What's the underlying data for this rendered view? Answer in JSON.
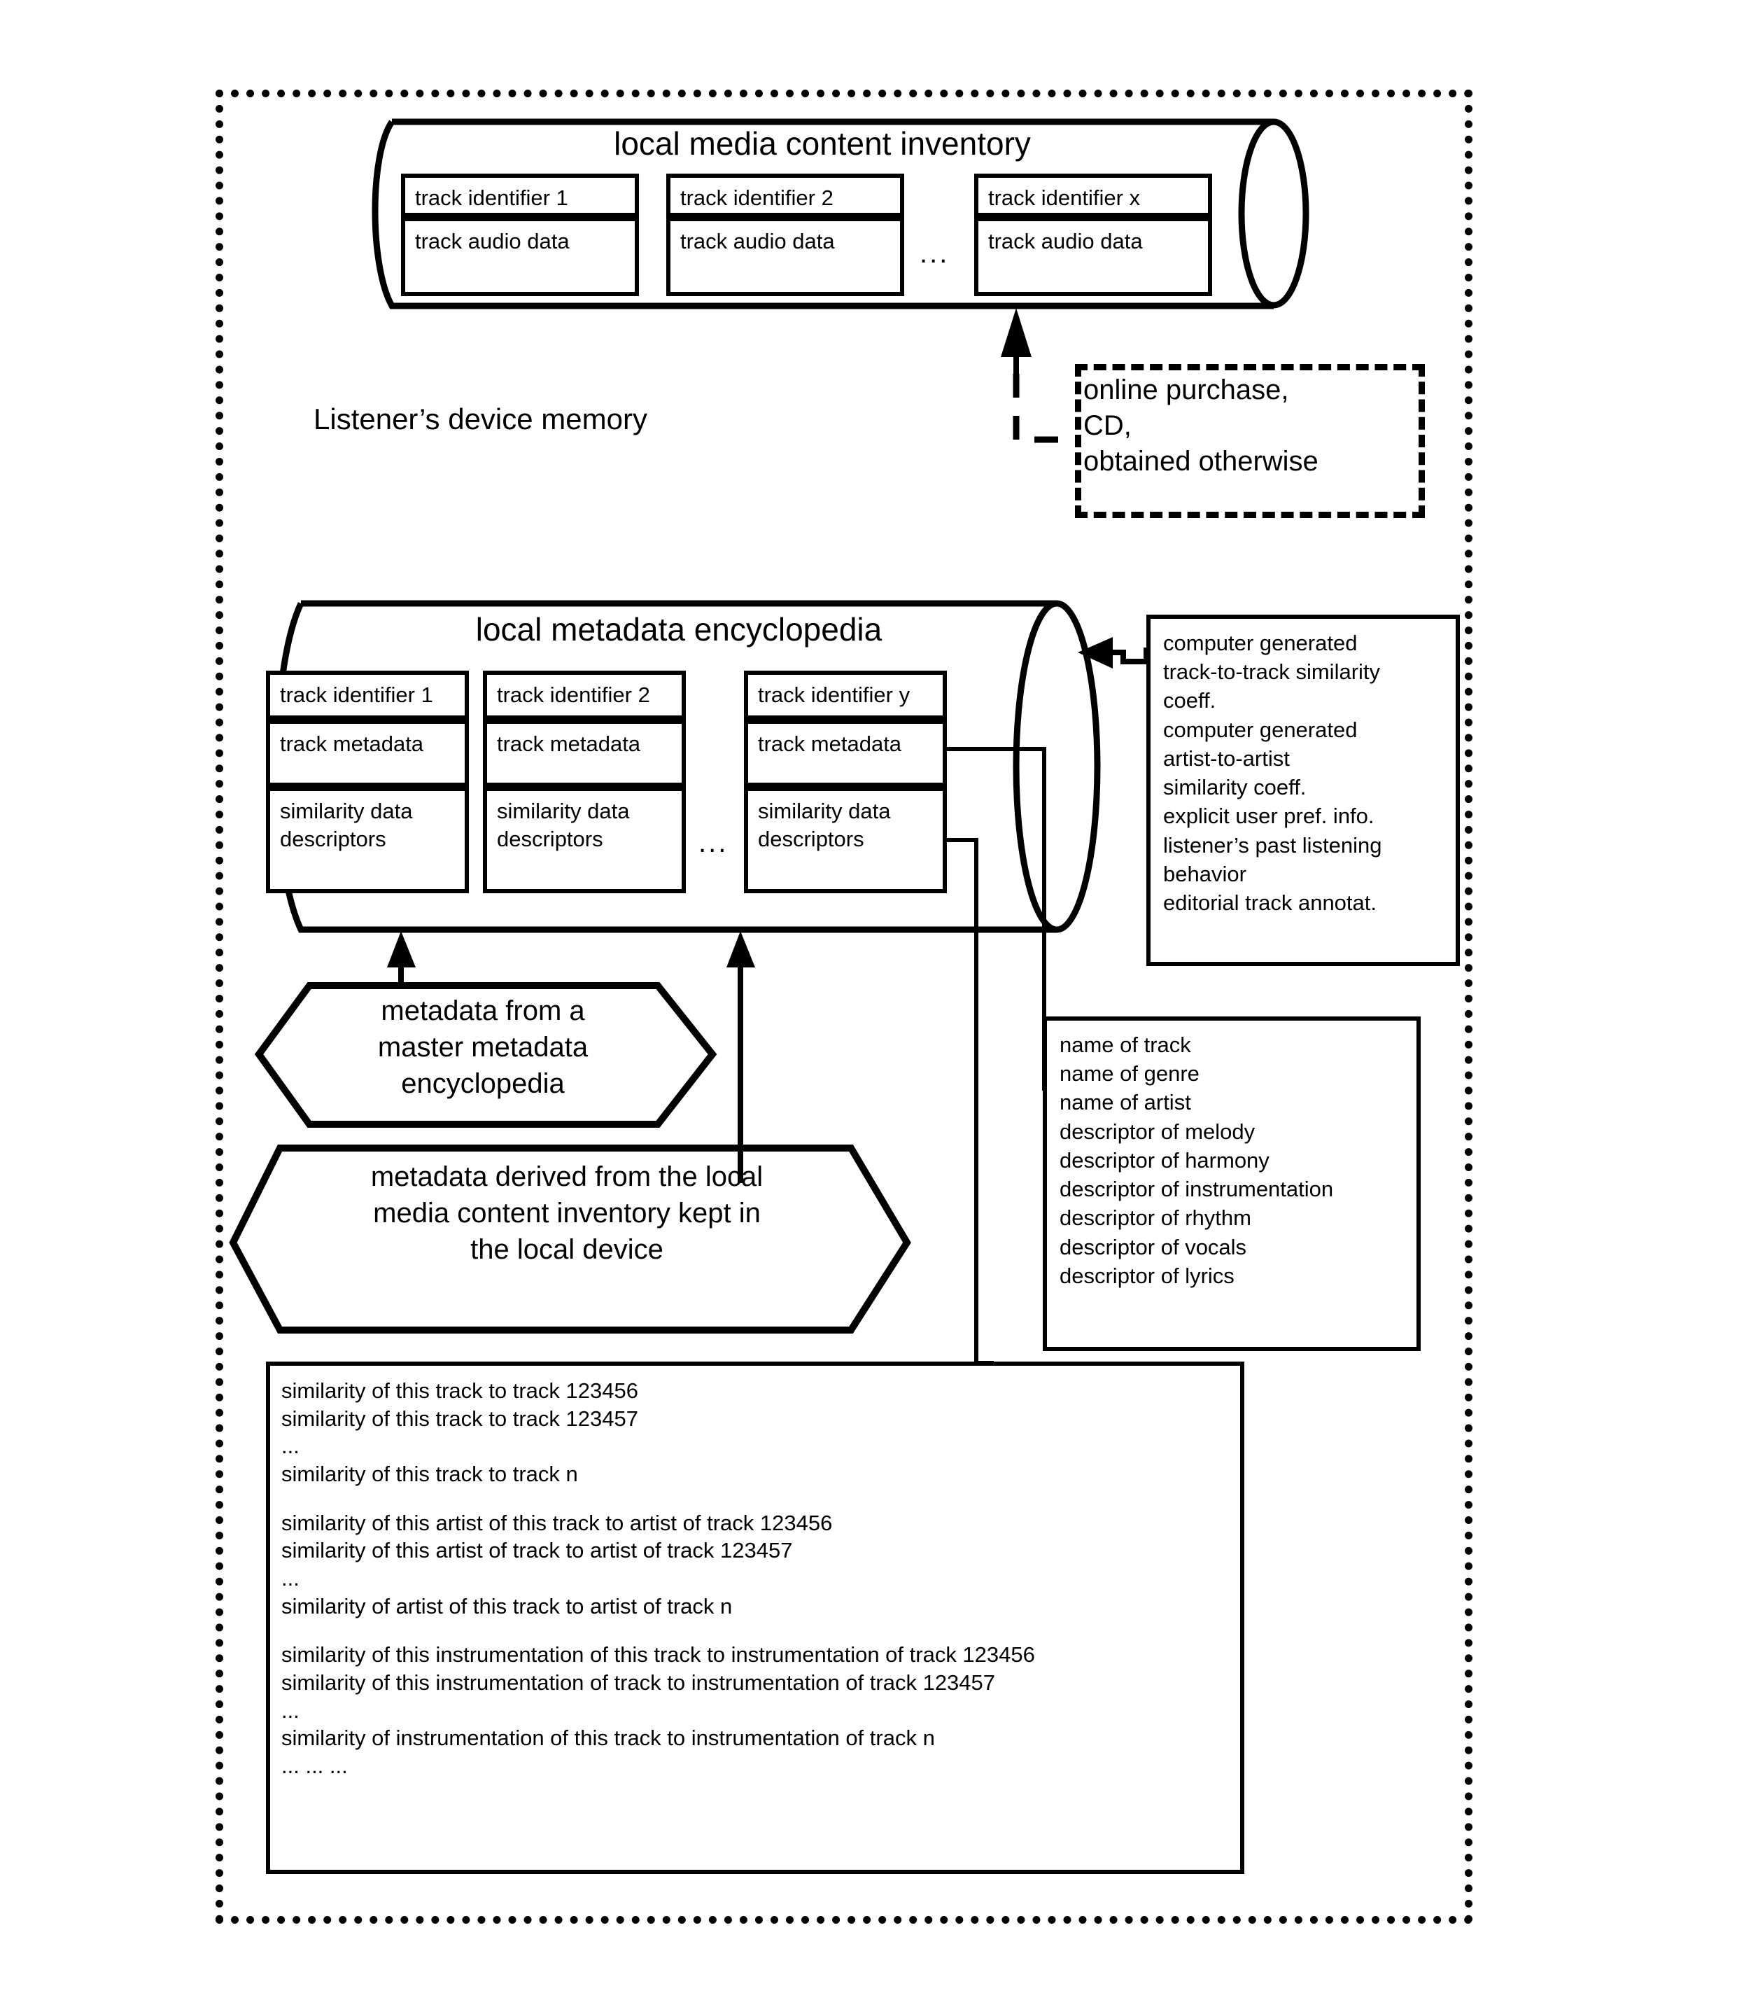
{
  "diagram": {
    "device_boundary_label": "Listener’s device memory",
    "media_inventory": {
      "title": "local media content inventory",
      "ellipsis": "...",
      "tracks": [
        {
          "identifier": "track identifier 1",
          "audio": "track audio data"
        },
        {
          "identifier": "track identifier 2",
          "audio": "track audio data"
        },
        {
          "identifier": "track identifier x",
          "audio": "track audio data"
        }
      ]
    },
    "acquisition_note": {
      "lines": [
        "online purchase,",
        "CD,",
        "obtained otherwise"
      ]
    },
    "metadata_encyclopedia": {
      "title": "local metadata encyclopedia",
      "ellipsis": "...",
      "entries": [
        {
          "identifier": "track identifier 1",
          "metadata": "track metadata",
          "similarity": [
            "similarity data",
            "descriptors"
          ]
        },
        {
          "identifier": "track identifier 2",
          "metadata": "track metadata",
          "similarity": [
            "similarity data",
            "descriptors"
          ]
        },
        {
          "identifier": "track identifier y",
          "metadata": "track metadata",
          "similarity": [
            "similarity data",
            "descriptors"
          ]
        }
      ]
    },
    "similarity_sources_box": {
      "lines": [
        "computer generated",
        "track-to-track similarity",
        "coeff.",
        "computer generated",
        "artist-to-artist",
        "similarity coeff.",
        "explicit user pref. info.",
        "listener’s past listening",
        "behavior",
        "editorial track annotat."
      ]
    },
    "track_metadata_box": {
      "lines": [
        "name of track",
        "name of genre",
        "name of artist",
        "descriptor of melody",
        "descriptor of harmony",
        "descriptor of instrumentation",
        "descriptor of rhythm",
        "descriptor of vocals",
        "descriptor of lyrics"
      ]
    },
    "similarity_descriptors_box": {
      "lines": [
        "similarity of this track to track 123456",
        "similarity of this track to track 123457",
        "...",
        "similarity of this track to track n",
        "",
        "similarity of this artist of this track to artist of track 123456",
        "similarity of this artist of track to artist of track 123457",
        "...",
        "similarity of artist of this track to artist of track n",
        "",
        "similarity of this instrumentation of this track to instrumentation of track 123456",
        "similarity of this instrumentation of track to instrumentation of track 123457",
        "...",
        "similarity of instrumentation of this track to instrumentation of track n",
        "... ... ..."
      ]
    },
    "callout_master_metadata": {
      "lines": [
        "metadata from a",
        "master metadata",
        "encyclopedia"
      ]
    },
    "callout_derived_metadata": {
      "lines": [
        "metadata derived from the local",
        "media content inventory kept in",
        "the local device"
      ]
    }
  }
}
